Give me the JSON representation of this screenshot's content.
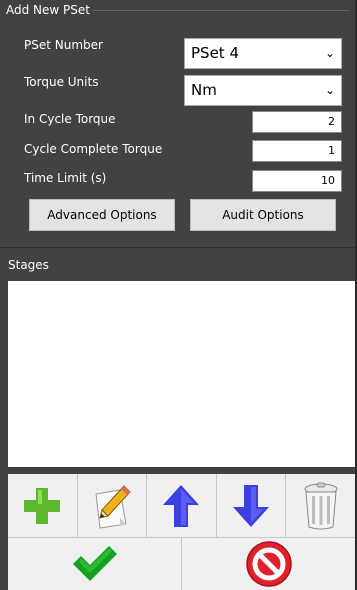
{
  "dialog": {
    "title": "Add New PSet"
  },
  "form": {
    "pset_number_label": "PSet Number",
    "pset_number_value": "PSet 4",
    "torque_units_label": "Torque Units",
    "torque_units_value": "Nm",
    "in_cycle_torque_label": "In Cycle Torque",
    "in_cycle_torque_value": "2",
    "cycle_complete_torque_label": "Cycle Complete Torque",
    "cycle_complete_torque_value": "1",
    "time_limit_label": "Time Limit (s)",
    "time_limit_value": "10"
  },
  "buttons": {
    "advanced_options": "Advanced Options",
    "audit_options": "Audit Options"
  },
  "stages": {
    "header": "Stages",
    "items": []
  },
  "icons": {
    "add": "plus-icon",
    "edit": "pencil-icon",
    "move_up": "arrow-up-icon",
    "move_down": "arrow-down-icon",
    "delete": "trash-icon",
    "confirm": "checkmark-icon",
    "cancel": "no-entry-icon"
  },
  "colors": {
    "panel": "#424242",
    "add_green": "#5cb82e",
    "arrow_blue": "#3b3fe0",
    "confirm_green": "#15a01f",
    "cancel_red": "#e0202a"
  }
}
